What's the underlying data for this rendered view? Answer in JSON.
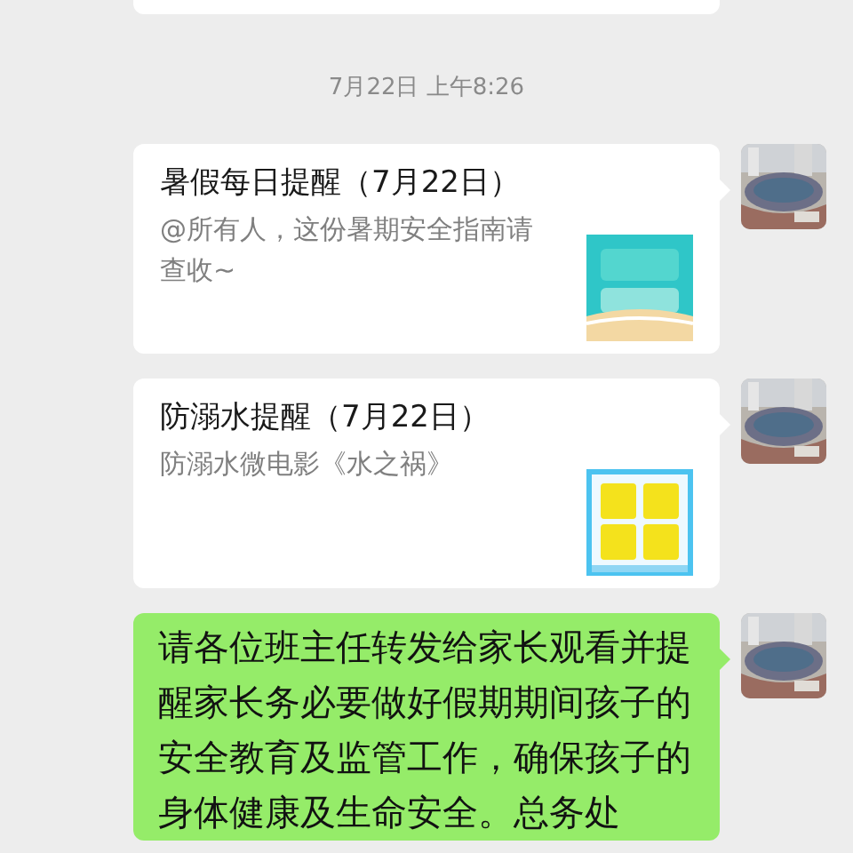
{
  "timestamp": "7月22日 上午8:26",
  "messages": [
    {
      "kind": "card",
      "title": "暑假每日提醒（7月22日）",
      "description": "@所有人，这份暑期安全指南请查收~"
    },
    {
      "kind": "card",
      "title": "防溺水提醒（7月22日）",
      "description": "防溺水微电影《水之祸》"
    },
    {
      "kind": "text",
      "text": "请各位班主任转发给家长观看并提醒家长务必要做好假期期间孩子的安全教育及监管工作，确保孩子的身体健康及生命安全。总务处"
    }
  ]
}
